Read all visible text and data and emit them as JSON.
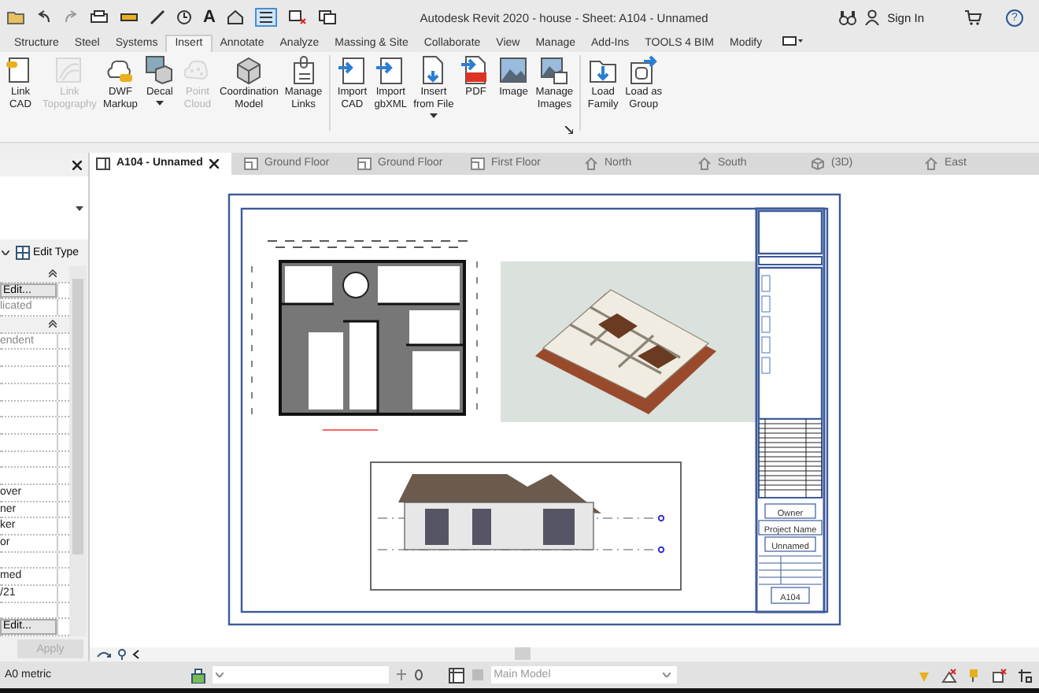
{
  "window": {
    "title": "Autodesk Revit 2020 - house - Sheet: A104 - Unnamed"
  },
  "quick_access": {
    "text_glyph": "A"
  },
  "account": {
    "sign_in": "Sign In",
    "help": "?"
  },
  "ribbon": {
    "tabs": [
      {
        "label": "Structure",
        "selected": false
      },
      {
        "label": "Steel",
        "selected": false
      },
      {
        "label": "Systems",
        "selected": false
      },
      {
        "label": "Insert",
        "selected": true
      },
      {
        "label": "Annotate",
        "selected": false
      },
      {
        "label": "Analyze",
        "selected": false
      },
      {
        "label": "Massing & Site",
        "selected": false
      },
      {
        "label": "Collaborate",
        "selected": false
      },
      {
        "label": "View",
        "selected": false
      },
      {
        "label": "Manage",
        "selected": false
      },
      {
        "label": "Add-Ins",
        "selected": false
      },
      {
        "label": "TOOLS 4 BIM",
        "selected": false
      },
      {
        "label": "Modify",
        "selected": false
      }
    ],
    "groups": [
      {
        "launcher": false,
        "buttons": [
          {
            "label": "Link\nCAD",
            "disabled": false,
            "dropdown": false
          },
          {
            "label": "Link\nTopography",
            "disabled": true,
            "dropdown": false
          },
          {
            "label": "DWF\nMarkup",
            "disabled": false,
            "dropdown": false
          },
          {
            "label": "Decal",
            "disabled": false,
            "dropdown": true
          },
          {
            "label": "Point\nCloud",
            "disabled": true,
            "dropdown": false
          },
          {
            "label": "Coordination\nModel",
            "disabled": false,
            "dropdown": false
          },
          {
            "label": "Manage\nLinks",
            "disabled": false,
            "dropdown": false
          }
        ]
      },
      {
        "launcher": true,
        "buttons": [
          {
            "label": "Import\nCAD",
            "disabled": false,
            "dropdown": false
          },
          {
            "label": "Import\ngbXML",
            "disabled": false,
            "dropdown": false
          },
          {
            "label": "Insert\nfrom File",
            "disabled": false,
            "dropdown": true
          },
          {
            "label": "PDF",
            "disabled": false,
            "dropdown": false
          },
          {
            "label": "Image",
            "disabled": false,
            "dropdown": false
          },
          {
            "label": "Manage\nImages",
            "disabled": false,
            "dropdown": false
          }
        ]
      },
      {
        "launcher": false,
        "buttons": [
          {
            "label": "Load\nFamily",
            "disabled": false,
            "dropdown": false
          },
          {
            "label": "Load as\nGroup",
            "disabled": false,
            "dropdown": false
          }
        ]
      }
    ]
  },
  "properties": {
    "edit_type": "Edit Type",
    "rows": [
      {
        "kind": "header"
      },
      {
        "kind": "button",
        "text": "Edit..."
      },
      {
        "kind": "text",
        "text": "licated",
        "disabled": true
      },
      {
        "kind": "header"
      },
      {
        "kind": "text",
        "text": "endent",
        "disabled": true
      },
      {
        "kind": "blank"
      },
      {
        "kind": "blank"
      },
      {
        "kind": "blank"
      },
      {
        "kind": "blank"
      },
      {
        "kind": "blank"
      },
      {
        "kind": "blank"
      },
      {
        "kind": "blank"
      },
      {
        "kind": "blank"
      },
      {
        "kind": "text",
        "text": "over",
        "disabled": false
      },
      {
        "kind": "text",
        "text": "ner",
        "disabled": false
      },
      {
        "kind": "text",
        "text": "ker",
        "disabled": false
      },
      {
        "kind": "text",
        "text": "or",
        "disabled": false
      },
      {
        "kind": "blank"
      },
      {
        "kind": "text",
        "text": "med",
        "disabled": false
      },
      {
        "kind": "text",
        "text": "/21",
        "disabled": false
      },
      {
        "kind": "blank"
      },
      {
        "kind": "button",
        "text": "Edit..."
      }
    ],
    "apply": {
      "label": "Apply",
      "disabled": true
    }
  },
  "view_tabs": [
    {
      "label": "A104 - Unnamed",
      "kind": "sheet",
      "selected": true
    },
    {
      "label": "Ground Floor",
      "kind": "plan",
      "selected": false
    },
    {
      "label": "Ground Floor",
      "kind": "plan",
      "selected": false
    },
    {
      "label": "First Floor",
      "kind": "plan",
      "selected": false
    },
    {
      "label": "North",
      "kind": "elevation",
      "selected": false
    },
    {
      "label": "South",
      "kind": "elevation",
      "selected": false
    },
    {
      "label": "(3D)",
      "kind": "isometric",
      "selected": false
    },
    {
      "label": "East",
      "kind": "elevation",
      "selected": false
    }
  ],
  "sheet": {
    "title_block": {
      "owner": "Owner",
      "project_name": "Project Name",
      "sheet_name": "Unnamed",
      "sheet_number": "A104"
    }
  },
  "status_bar": {
    "scale": "A0 metric",
    "model": "Main Model"
  }
}
